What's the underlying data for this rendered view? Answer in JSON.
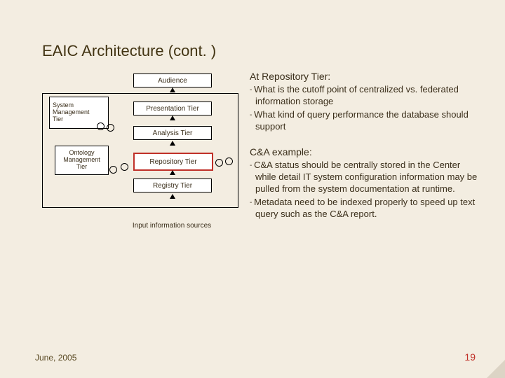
{
  "title": "EAIC Architecture (cont. )",
  "diagram": {
    "audience": "Audience",
    "presentation": "Presentation Tier",
    "analysis": "Analysis Tier",
    "repository": "Repository Tier",
    "registry": "Registry Tier",
    "inputinfo": "Input information sources",
    "sysmgmt_l1": "System",
    "sysmgmt_l2": "Management",
    "sysmgmt_l3": "Tier",
    "ontomgmt_l1": "Ontology",
    "ontomgmt_l2": "Management",
    "ontomgmt_l3": "Tier"
  },
  "right": {
    "h1": "At Repository Tier:",
    "b1": "What is the cutoff point of centralized vs. federated information storage",
    "b2": "What kind of query performance the database should support",
    "h2": "C&A example:",
    "b3": "C&A status should be centrally stored in the Center while detail IT system configuration information may be pulled from the system documentation at runtime.",
    "b4": "Metadata need to be indexed properly to speed up text query such as the C&A report."
  },
  "footer": {
    "date": "June, 2005",
    "page": "19"
  },
  "dash": "- "
}
